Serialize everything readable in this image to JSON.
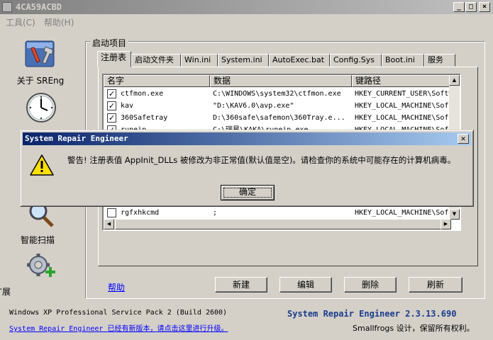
{
  "window": {
    "title": "4CA59ACBD"
  },
  "menu": {
    "tools": "工具(C)",
    "help": "帮助(H)"
  },
  "sidebar": {
    "items": [
      {
        "label": "关于 SREng",
        "icon": "tools-icon"
      },
      {
        "label": "",
        "icon": "clock-icon"
      },
      {
        "label": "智能扫描",
        "icon": "magnifier-icon"
      },
      {
        "label": "扩展",
        "icon": "gear-plus-icon"
      }
    ]
  },
  "group": {
    "title": "启动项目"
  },
  "tabs": [
    "注册表",
    "启动文件夹",
    "Win.ini",
    "System.ini",
    "AutoExec.bat",
    "Config.Sys",
    "Boot.ini",
    "服务"
  ],
  "list": {
    "columns": [
      "名字",
      "数据",
      "键路径"
    ],
    "rows": [
      {
        "checked": true,
        "name": "ctfmon.exe",
        "data": "C:\\WINDOWS\\system32\\ctfmon.exe",
        "path": "HKEY_CURRENT_USER\\Softw"
      },
      {
        "checked": true,
        "name": "kav",
        "data": "\"D:\\KAV6.0\\avp.exe\"",
        "path": "HKEY_LOCAL_MACHINE\\Sof"
      },
      {
        "checked": true,
        "name": "360Safetray",
        "data": "D:\\360safe\\safemon\\360Tray.e...",
        "path": "HKEY_LOCAL_MACHINE\\Sof"
      },
      {
        "checked": true,
        "name": "runeip",
        "data": "C:\\瑞星\\KAKA\\runeip.exe",
        "path": "HKEY_LOCAL_MACHINE\\Sof"
      },
      {
        "checked": false,
        "name": "rgfxhkcmd",
        "data": ";",
        "path": "HKEY_LOCAL_MACHINE\\Sof"
      }
    ]
  },
  "help_link": "帮助",
  "buttons": {
    "new": "新建",
    "edit": "编辑",
    "delete": "删除",
    "refresh": "刷新"
  },
  "status": {
    "os": "Windows XP Professional Service Pack 2 (Build 2600)",
    "update_link": "System Repair Engineer 已经有新版本，请点击这里进行升级。",
    "version": "System Repair Engineer 2.3.13.690",
    "copyright": "Smallfrogs 设计，保留所有权利。"
  },
  "dialog": {
    "title": "System Repair Engineer",
    "message": "警告! 注册表值 AppInit_DLLs 被修改为非正常值(默认值是空)。请检查你的系统中可能存在的计算机病毒。",
    "ok": "确定"
  }
}
